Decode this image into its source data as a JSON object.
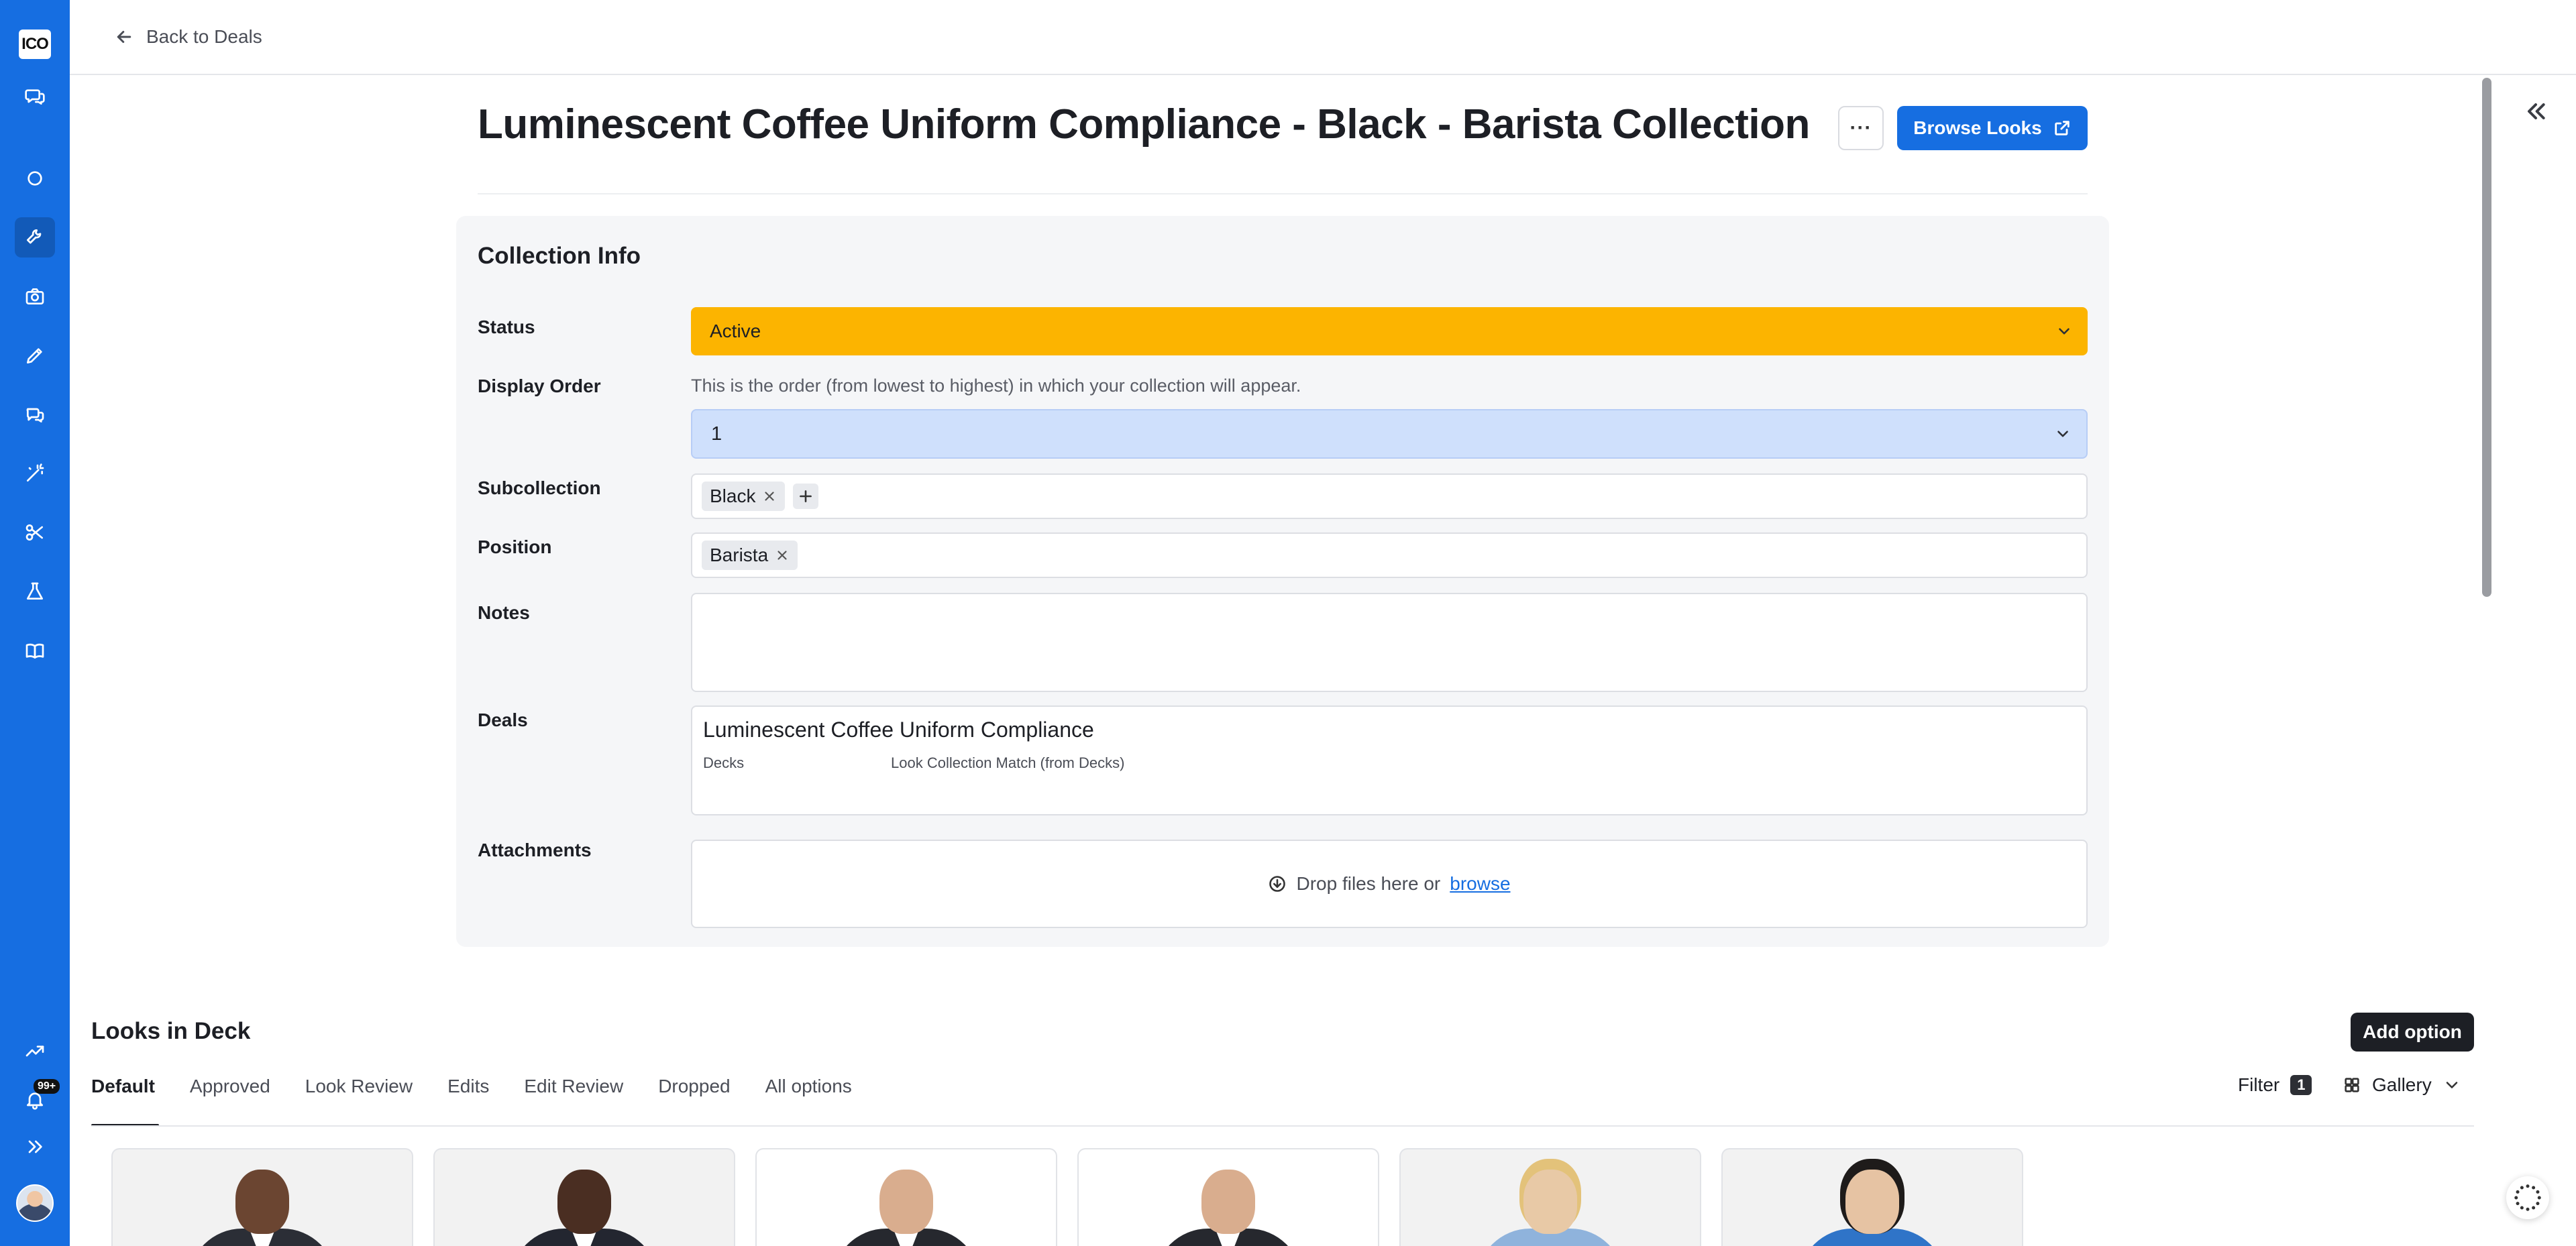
{
  "rail": {
    "logo_text": "ICO",
    "icons": [
      "chat-bubbles-icon",
      "circle-icon",
      "tools-icon",
      "camera-icon",
      "pencil-icon",
      "messages-icon",
      "magic-wand-icon",
      "scissors-icon",
      "flask-icon",
      "book-icon",
      "trend-chart-icon",
      "bell-icon",
      "expand-chevrons-icon"
    ],
    "notification_badge": "99+",
    "accent": "#166ee1"
  },
  "topbar": {
    "back_label": "Back to Deals"
  },
  "header": {
    "title": "Luminescent Coffee Uniform Compliance - Black - Barista Collection",
    "more_label": "···",
    "browse_label": "Browse Looks"
  },
  "collection_info": {
    "heading": "Collection Info",
    "status": {
      "label": "Status",
      "value": "Active",
      "color": "#fcb400"
    },
    "display_order": {
      "label": "Display Order",
      "help": "This is the order (from lowest to highest) in which your collection will appear.",
      "value": "1"
    },
    "subcollection": {
      "label": "Subcollection",
      "tags": [
        "Black"
      ]
    },
    "position": {
      "label": "Position",
      "tags": [
        "Barista"
      ]
    },
    "notes": {
      "label": "Notes",
      "value": ""
    },
    "deals": {
      "label": "Deals",
      "name": "Luminescent Coffee Uniform Compliance",
      "field1": "Decks",
      "field2": "Look Collection Match (from Decks)"
    },
    "attachments": {
      "label": "Attachments",
      "drop_text": "Drop files here or",
      "browse_link": "browse"
    }
  },
  "looks": {
    "heading": "Looks in Deck",
    "add_label": "Add option",
    "tabs": [
      "Default",
      "Approved",
      "Look Review",
      "Edits",
      "Edit Review",
      "Dropped",
      "All options"
    ],
    "active_tab": "Default",
    "filter_label": "Filter",
    "filter_count": "1",
    "view_label": "Gallery"
  }
}
